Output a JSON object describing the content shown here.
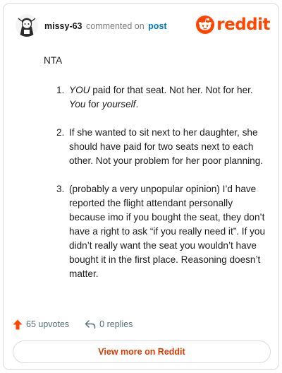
{
  "header": {
    "author": "missy-63",
    "action": "commented on",
    "post_link": "post",
    "brand": "reddit"
  },
  "comment": {
    "intro": "NTA",
    "items": [
      {
        "number": "1.",
        "em1": "YOU",
        "text1": " paid for that seat. Not her. Not for her. ",
        "em2": "You",
        "text2": " for ",
        "em3": "yourself",
        "text3": "."
      },
      {
        "number": "2.",
        "text": "If she wanted to sit next to her daughter, she should have paid for two seats next to each other. Not your problem for her poor planning."
      },
      {
        "number": "3.",
        "text": "(probably a very unpopular opinion) I’d have reported the flight attendant personally because imo if you bought the seat, they don’t have a right to ask “if you really need it”. If you didn’t really want the seat you wouldn’t have bought it in the first place. Reasoning doesn’t matter."
      }
    ]
  },
  "footer": {
    "upvotes": "65 upvotes",
    "replies": "0 replies",
    "view_more": "View more on Reddit"
  },
  "colors": {
    "brand": "#ff4500",
    "link": "#0079d3",
    "view_more": "#d93a00",
    "muted": "#576f76"
  },
  "icons": [
    "avatar-icon",
    "reddit-alien-icon",
    "upvote-arrow-icon",
    "reply-arrow-icon"
  ]
}
